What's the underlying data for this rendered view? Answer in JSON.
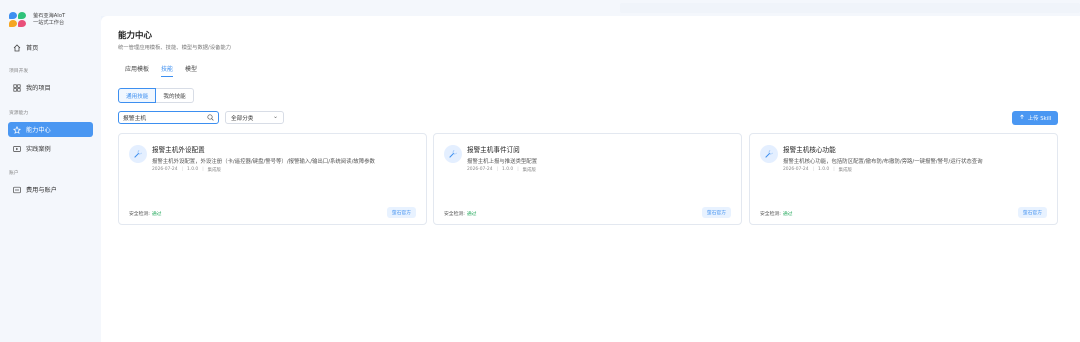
{
  "app": {
    "logo_line1": "萤石亚海AIoT",
    "logo_line2": "一站式工作台",
    "brand_colors": [
      "#3d8ff0",
      "#2fc27a",
      "#f5a623",
      "#e9507a"
    ]
  },
  "sidebar": {
    "home": "首页",
    "group_project": "项目开发",
    "my_projects": "我的项目",
    "group_capability": "资源能力",
    "capability_center": "能力中心",
    "cases": "实践案例",
    "group_account": "账户",
    "billing": "费用与账户"
  },
  "page": {
    "title": "能力中心",
    "subtitle": "统一管理应用模板、技能、模型与数据/设备能力",
    "tabs": [
      "应用模板",
      "技能",
      "模型"
    ],
    "active_tab": "技能"
  },
  "segment": {
    "options": [
      "通用技能",
      "我的技能"
    ],
    "active": "通用技能"
  },
  "filters": {
    "search_value": "报警主机",
    "category_select": "全部分类"
  },
  "toolbar": {
    "upload_label": "上传 Skill"
  },
  "cards": [
    {
      "title": "报警主机外设配置",
      "desc": "报警主机外设配置，外设注册（卡/遥控器/键盘/警号等）/报警输入/输出口/系统阅读/故障参数",
      "date": "2026-07-24",
      "version": "1.0.0",
      "tag": "集成版",
      "security_label": "安全检测:",
      "security_status": "通过",
      "action": "萤石官方"
    },
    {
      "title": "报警主机事件订阅",
      "desc": "报警主机上报与推送类型配置",
      "date": "2026-07-24",
      "version": "1.0.0",
      "tag": "集成版",
      "security_label": "安全检测:",
      "security_status": "通过",
      "action": "萤石官方"
    },
    {
      "title": "报警主机核心功能",
      "desc": "报警主机核心功能，包括防区配置/撤布防/布撤防/旁路/一键报警/警号/运行状态查询",
      "date": "2026-07-24",
      "version": "1.0.0",
      "tag": "集成版",
      "security_label": "安全检测:",
      "security_status": "通过",
      "action": "萤石官方"
    }
  ]
}
